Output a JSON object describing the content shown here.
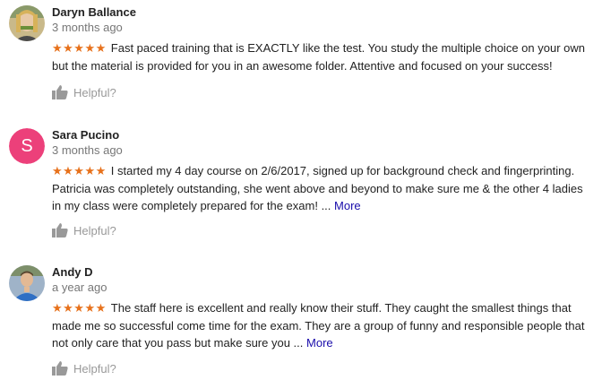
{
  "reviews": [
    {
      "author": "Daryn Ballance",
      "date": "3 months ago",
      "stars": "★★★★★",
      "text": "Fast paced training that is EXACTLY like the test. You study the multiple choice on your own but the material is provided for you in an awesome folder. Attentive and focused on your success!",
      "more": "",
      "helpful": "Helpful?",
      "avatar_type": "photo"
    },
    {
      "author": "Sara Pucino",
      "date": "3 months ago",
      "stars": "★★★★★",
      "text": "I started my 4 day course on 2/6/2017, signed up for background check and fingerprinting. Patricia was completely outstanding, she went above and beyond to make sure me & the other 4 ladies in my class were completely prepared for the exam! ...",
      "more": "More",
      "helpful": "Helpful?",
      "avatar_letter": "S",
      "avatar_color": "#ec407a"
    },
    {
      "author": "Andy D",
      "date": "a year ago",
      "stars": "★★★★★",
      "text": "The staff here is excellent and really know their stuff. They caught the smallest things that made me so successful come time for the exam. They are a group of funny and responsible people that not only care that you pass but make sure you ...",
      "more": "More",
      "helpful": "Helpful?",
      "avatar_type": "photo"
    }
  ],
  "colors": {
    "star": "#e7711b",
    "link": "#1a0dab",
    "muted": "#777777",
    "helpful": "#999999"
  }
}
